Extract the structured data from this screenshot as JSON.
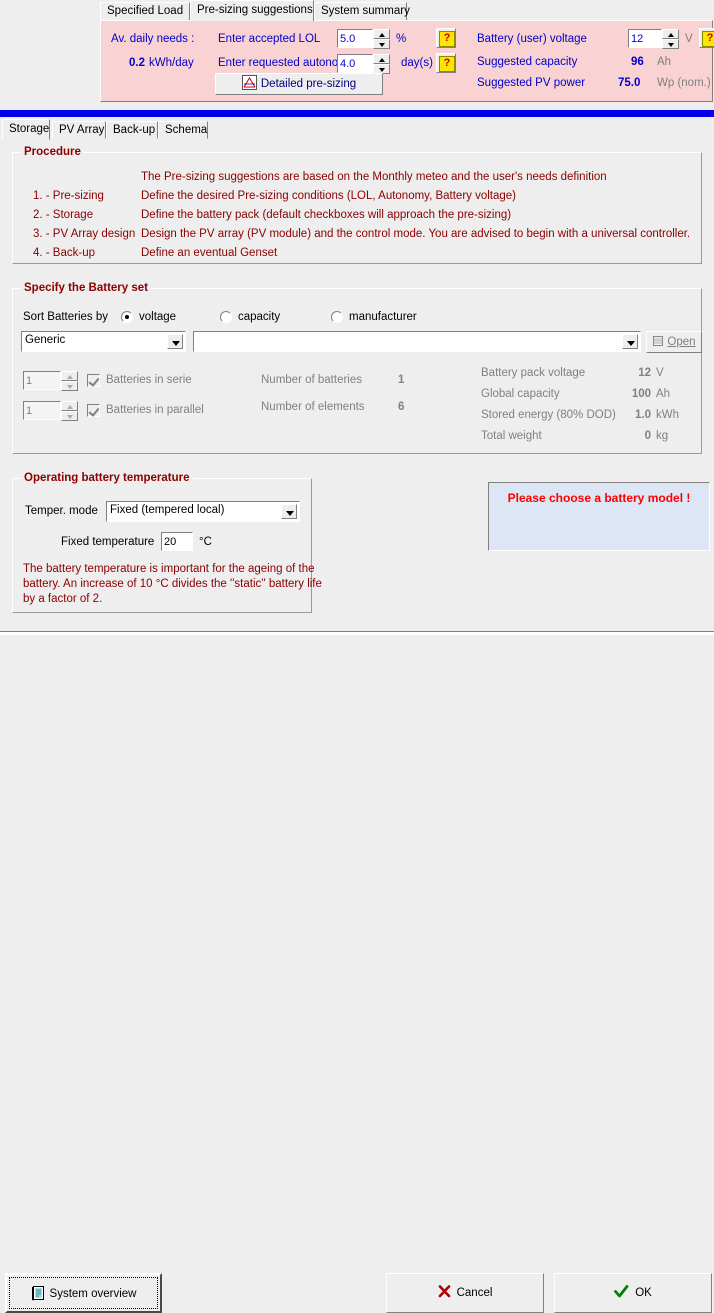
{
  "top_tabs": [
    {
      "label": "Specified Load",
      "active": false
    },
    {
      "label": "Pre-sizing suggestions",
      "active": true
    },
    {
      "label": "System summary",
      "active": false
    }
  ],
  "presizing_panel": {
    "av_daily_needs_label": "Av. daily needs :",
    "av_daily_needs_value": "0.2",
    "av_daily_needs_unit": "kWh/day",
    "lol_label": "Enter accepted LOL",
    "lol_value": "5.0",
    "lol_unit": "%",
    "autonomy_label": "Enter requested autonomy",
    "autonomy_value": "4.0",
    "autonomy_unit": "day(s)",
    "help_label": "?",
    "detailed_button": "Detailed pre-sizing",
    "battery_voltage_label": "Battery (user) voltage",
    "battery_voltage_value": "12",
    "battery_voltage_unit": "V",
    "suggested_capacity_label": "Suggested capacity",
    "suggested_capacity_value": "96",
    "suggested_capacity_unit": "Ah",
    "suggested_pv_label": "Suggested PV power",
    "suggested_pv_value": "75.0",
    "suggested_pv_unit": "Wp (nom.)"
  },
  "sub_tabs": [
    {
      "label": "Storage",
      "active": true
    },
    {
      "label": "PV Array",
      "active": false
    },
    {
      "label": "Back-up",
      "active": false
    },
    {
      "label": "Schema",
      "active": false
    }
  ],
  "procedure": {
    "title": "Procedure",
    "intro": "The Pre-sizing  suggestions are based on the Monthly meteo and the user's needs definition",
    "rows": [
      {
        "step": "1. - Pre-sizing",
        "desc": "Define the desired Pre-sizing  conditions  (LOL, Autonomy, Battery voltage)"
      },
      {
        "step": "2. - Storage",
        "desc": "Define the battery pack   (default checkboxes will approach the pre-sizing)"
      },
      {
        "step": "3. - PV Array design",
        "desc": "Design the PV array  (PV module) and the control mode. You are advised to begin with a universal controller."
      },
      {
        "step": "4. - Back-up",
        "desc": "Define an eventual Genset"
      }
    ]
  },
  "battery_set": {
    "title": "Specify the Battery set",
    "sort_label": "Sort Batteries by",
    "sort_options": [
      {
        "label": "voltage",
        "selected": true
      },
      {
        "label": "capacity",
        "selected": false
      },
      {
        "label": "manufacturer",
        "selected": false
      }
    ],
    "manufacturer_combo_value": "Generic",
    "model_combo_value": "",
    "open_button": "Open",
    "series_value": "1",
    "series_label": "Batteries in serie",
    "parallel_value": "1",
    "parallel_label": "Batteries in parallel",
    "number_of_batteries_label": "Number of batteries",
    "number_of_batteries_value": "1",
    "number_of_elements_label": "Number of elements",
    "number_of_elements_value": "6",
    "results": [
      {
        "label": "Battery pack voltage",
        "value": "12",
        "unit": "V"
      },
      {
        "label": "Global capacity",
        "value": "100",
        "unit": "Ah"
      },
      {
        "label": "Stored energy (80% DOD)",
        "value": "1.0",
        "unit": "kWh"
      },
      {
        "label": "Total weight",
        "value": "0",
        "unit": "kg"
      }
    ]
  },
  "temperature": {
    "title": "Operating battery temperature",
    "mode_label": "Temper. mode",
    "mode_value": "Fixed  (tempered local)",
    "fixed_label": "Fixed temperature",
    "fixed_value": "20",
    "fixed_unit": "°C",
    "note_line1": "The battery temperature is important for the ageing of the",
    "note_line2": "battery. An increase of 10 °C divides the ''static'' battery life",
    "note_line3": "by a factor of 2."
  },
  "message_box": {
    "text": "Please choose a battery model !"
  },
  "footer": {
    "system_overview": "System overview",
    "cancel": "Cancel",
    "ok": "OK"
  },
  "colors": {
    "panel_pink": "#f9d2d3",
    "accent_blue": "#0000cc",
    "rule_blue": "#0000ee",
    "group_red": "#8b0000",
    "error_red": "#ff0000",
    "disabled_gray": "#808080",
    "msgbox_bg": "#dde6f5"
  }
}
